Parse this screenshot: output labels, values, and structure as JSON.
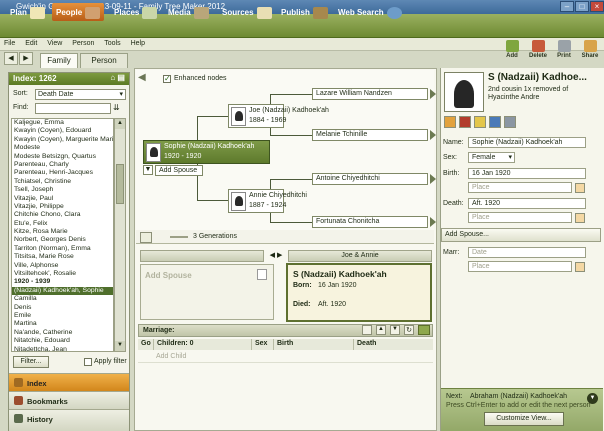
{
  "window": {
    "title": "Gwich'in Genealogy_2013-09-11 - Family Tree Maker 2012"
  },
  "nav": {
    "plan": "Plan",
    "people": "People",
    "places": "Places",
    "media": "Media",
    "sources": "Sources",
    "publish": "Publish",
    "web_search": "Web Search"
  },
  "menu": {
    "file": "File",
    "edit": "Edit",
    "view": "View",
    "person": "Person",
    "tools": "Tools",
    "help": "Help"
  },
  "toolbar": {
    "add": "Add",
    "delete": "Delete",
    "print": "Print",
    "share": "Share"
  },
  "tabs": {
    "family": "Family",
    "person": "Person"
  },
  "index": {
    "title": "Index: 1262",
    "sort_label": "Sort:",
    "sort_value": "Death Date",
    "find_label": "Find:",
    "find_value": "",
    "names": [
      {
        "text": "Kaljegue, Emma",
        "type": "name"
      },
      {
        "text": "Kwayin (Coyen), Edouard",
        "type": "name"
      },
      {
        "text": "Kwayin (Coyen), Marguerite Marie",
        "type": "name"
      },
      {
        "text": "Modeste",
        "type": "name"
      },
      {
        "text": "Modeste Betsizgn, Quartus",
        "type": "name"
      },
      {
        "text": "Parenteau, Charly",
        "type": "name"
      },
      {
        "text": "Parenteau, Henri-Jacques",
        "type": "name"
      },
      {
        "text": "Tchiatsel, Christine",
        "type": "name"
      },
      {
        "text": "Tsell, Joseph",
        "type": "name"
      },
      {
        "text": "Vitazjie, Paul",
        "type": "name"
      },
      {
        "text": "Vitazjie, Philippe",
        "type": "name"
      },
      {
        "text": "Chitchie Chono, Clara",
        "type": "name"
      },
      {
        "text": "Etu'e, Felix",
        "type": "name"
      },
      {
        "text": "Kitze, Rosa Marie",
        "type": "name"
      },
      {
        "text": "Norbert, Georges Denis",
        "type": "name"
      },
      {
        "text": "Tarriton (Norman), Emma",
        "type": "name"
      },
      {
        "text": "Titsitsa, Marie Rose",
        "type": "name"
      },
      {
        "text": "Ville, Alphonse",
        "type": "name"
      },
      {
        "text": "Vitsiltehcek', Rosalie",
        "type": "name"
      },
      {
        "text": "1920 - 1939",
        "type": "year"
      },
      {
        "text": "(Nadzaii) Kadhoek'ah, Sophie",
        "type": "selected"
      },
      {
        "text": "Camilla",
        "type": "name"
      },
      {
        "text": "Denis",
        "type": "name"
      },
      {
        "text": "Emile",
        "type": "name"
      },
      {
        "text": "Martina",
        "type": "name"
      },
      {
        "text": "Na'ande, Catherine",
        "type": "name"
      },
      {
        "text": "Nitatchie, Edouard",
        "type": "name"
      },
      {
        "text": "Nitadettcha, Jean",
        "type": "name"
      }
    ],
    "filter_label": "Filter...",
    "apply_filter_label": "Apply filter"
  },
  "left_nav": {
    "index": "Index",
    "bookmarks": "Bookmarks",
    "history": "History"
  },
  "tree": {
    "enhanced_nodes_label": "Enhanced nodes",
    "father": {
      "name": "Joe (Nadzaii) Kadhoek'ah",
      "years": "1884 - 1969"
    },
    "paternal_gf": "Lazare William Nandzen",
    "paternal_gm": "Melanie Tchinille",
    "self": {
      "name": "Sophie (Nadzaii) Kadhoek'ah",
      "years": "1920 - 1920"
    },
    "add_spouse": "Add Spouse",
    "mother": {
      "name": "Annie Chiyedhitchi",
      "years": "1887 - 1924"
    },
    "maternal_gf": "Antoine Chiyedhitchi",
    "maternal_gm": "Fortunata Chonitcha",
    "generations": "3 Generations"
  },
  "family": {
    "parents_label": "Joe & Annie",
    "add_spouse": "Add Spouse",
    "person_name": "S (Nadzaii) Kadhoek'ah",
    "born_label": "Born:",
    "born_value": "16 Jan 1920",
    "died_label": "Died:",
    "died_value": "Aft. 1920",
    "marriage_label": "Marriage:",
    "columns": {
      "go": "Go",
      "children": "Children: 0",
      "sex": "Sex",
      "birth": "Birth",
      "death": "Death"
    },
    "add_child": "Add Child"
  },
  "editor": {
    "name_title": "S (Nadzaii) Kadhoe...",
    "relationship": "2nd cousin 1x removed of Hyacinthe Andre",
    "name_label": "Name:",
    "name_value": "Sophie (Nadzaii) Kadhoek'ah",
    "sex_label": "Sex:",
    "sex_value": "Female",
    "birth_label": "Birth:",
    "birth_date": "16 Jan 1920",
    "birth_place": "Place",
    "death_label": "Death:",
    "death_date": "Aft. 1920",
    "death_place": "Place",
    "add_spouse": "Add Spouse...",
    "marr_label": "Marr:",
    "marr_date": "Date",
    "marr_place": "Place",
    "next_label": "Next:",
    "next_name": "Abraham (Nadzaii) Kadhoek'ah",
    "next_hint": "Press Ctrl+Enter to add or edit the next person",
    "customize_label": "Customize View..."
  }
}
